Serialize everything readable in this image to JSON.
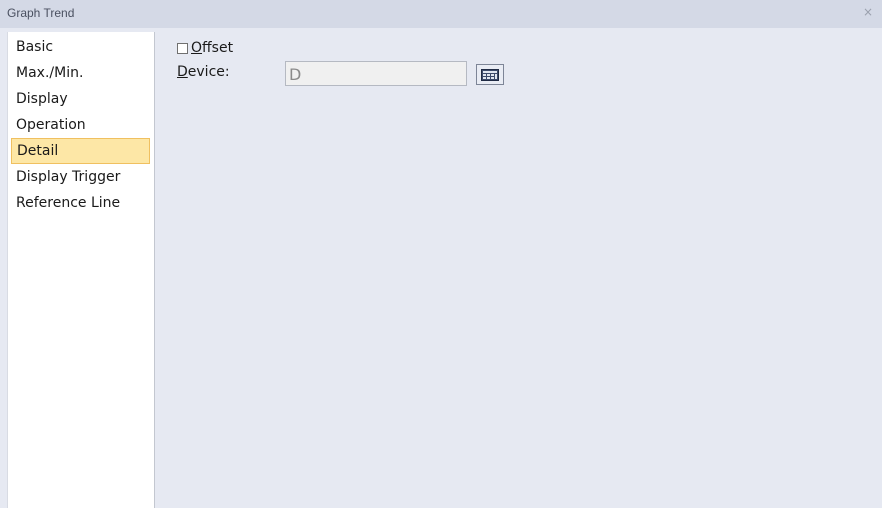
{
  "window": {
    "title": "Graph Trend",
    "close_glyph": "×"
  },
  "sidebar": {
    "items": [
      {
        "label": "Basic",
        "selected": false
      },
      {
        "label": "Max./Min.",
        "selected": false
      },
      {
        "label": "Display",
        "selected": false
      },
      {
        "label": "Operation",
        "selected": false
      },
      {
        "label": "Detail",
        "selected": true
      },
      {
        "label": "Display Trigger",
        "selected": false
      },
      {
        "label": "Reference Line",
        "selected": false
      }
    ]
  },
  "detail": {
    "offset": {
      "label_mnemonic": "O",
      "label_rest": "ffset",
      "checked": false
    },
    "device": {
      "label_mnemonic": "D",
      "label_rest": "evice:",
      "value": "D",
      "button_icon": "device-picker-icon"
    }
  },
  "colors": {
    "selected_bg": "#fde7a6",
    "selected_border": "#f0c060",
    "window_bg": "#e6e9f2",
    "titlebar_bg": "#d4d9e6"
  }
}
